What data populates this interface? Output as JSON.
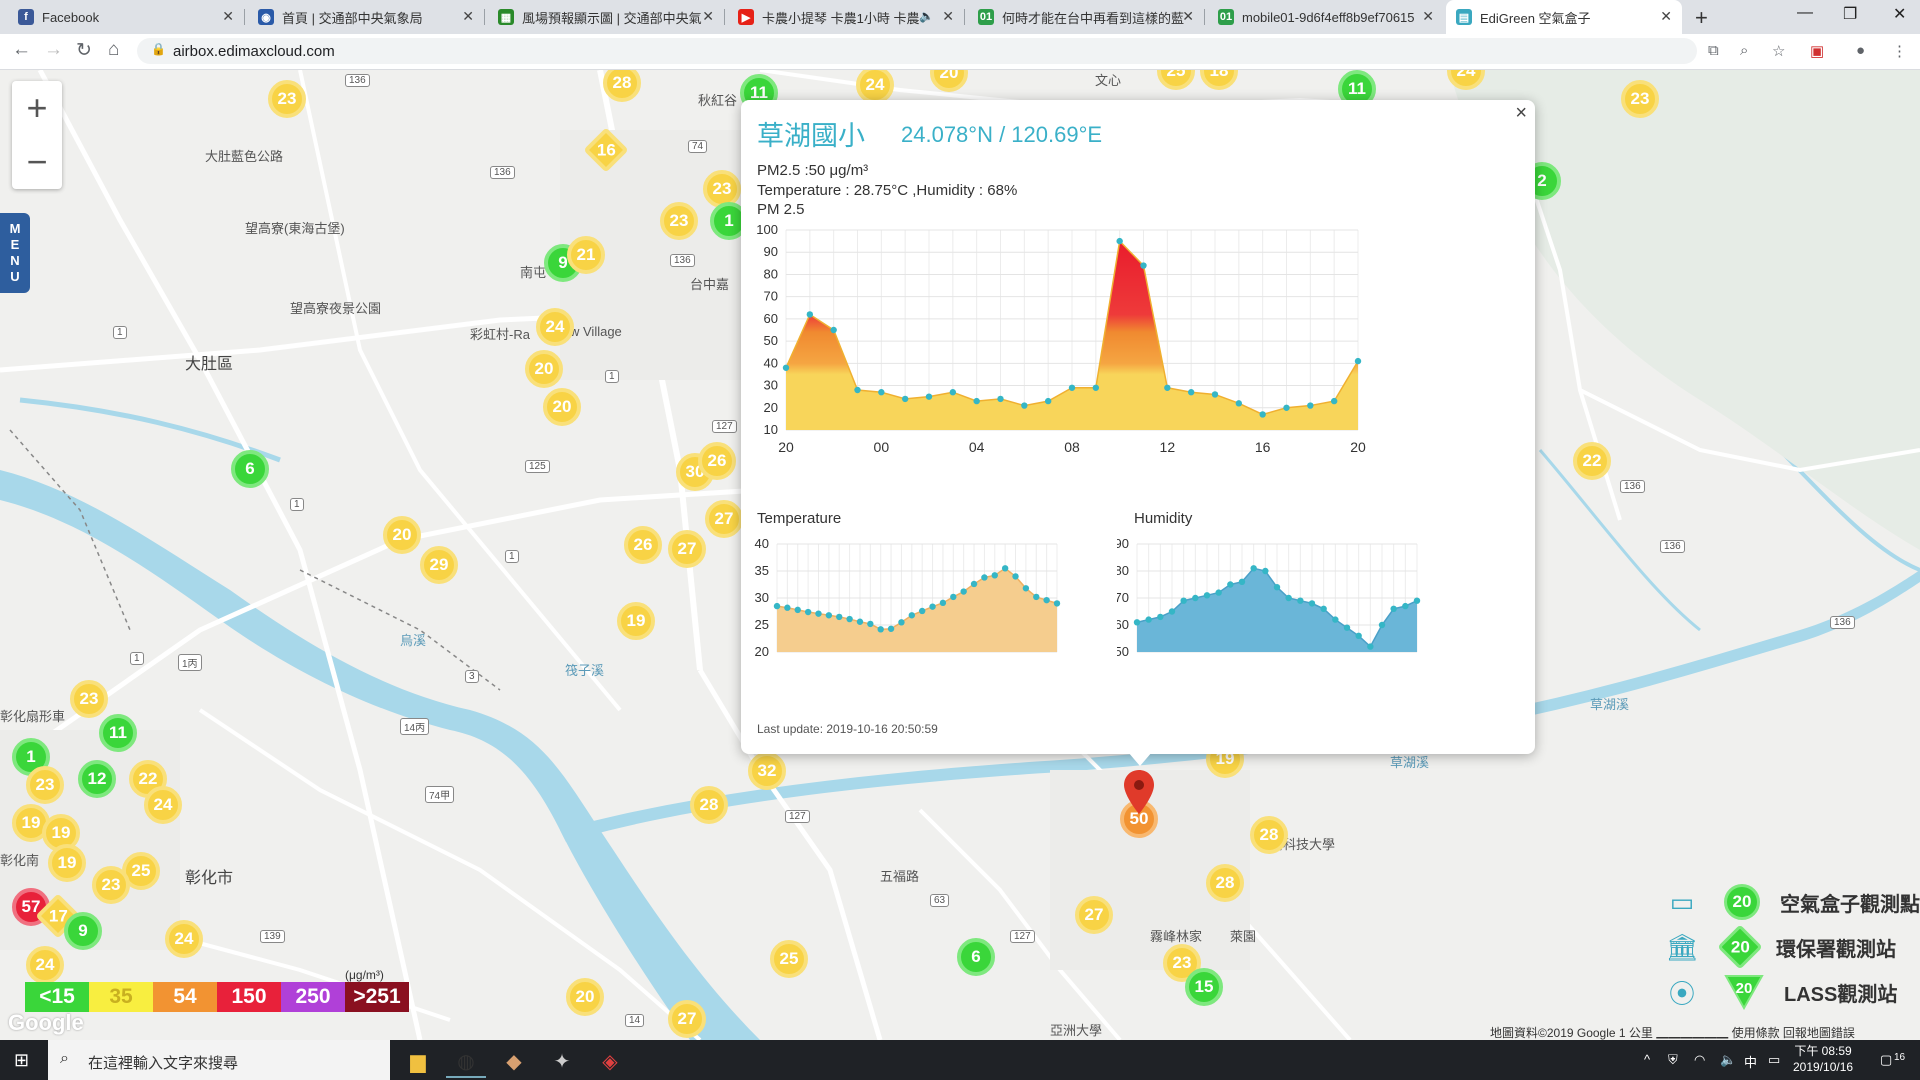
{
  "browser": {
    "tabs": [
      {
        "label": "Facebook",
        "icon": "facebook-icon",
        "color": "#3b5998",
        "glyph": "f"
      },
      {
        "label": "首頁 | 交通部中央氣象局",
        "icon": "cwb-icon",
        "color": "#2a5aa8",
        "glyph": "◉"
      },
      {
        "label": "風場預報顯示圖 | 交通部中央氣",
        "icon": "cwb-wind-icon",
        "color": "#2a8a2a",
        "glyph": "▦"
      },
      {
        "label": "卡農小提琴 卡農1小時 卡農",
        "icon": "youtube-icon",
        "color": "#e62117",
        "glyph": "▶"
      },
      {
        "label": "何時才能在台中再看到這樣的藍",
        "icon": "mobile01-icon",
        "color": "#2e9e4a",
        "glyph": "01"
      },
      {
        "label": "mobile01-9d6f4eff8b9ef70615",
        "icon": "mobile01-icon",
        "color": "#2e9e4a",
        "glyph": "01"
      },
      {
        "label": "EdiGreen 空氣盒子",
        "icon": "edigreen-icon",
        "color": "#3aa8c0",
        "glyph": "▤"
      }
    ],
    "url": "airbox.edimaxcloud.com"
  },
  "popup": {
    "site_name": "草湖國小",
    "coords": "24.078°N / 120.69°E",
    "pm25_line": "PM2.5 :50 μg/m³",
    "temp_hum_line": "Temperature : 28.75°C ,Humidity : 68%",
    "pm_label": "PM 2.5",
    "temp_label": "Temperature",
    "hum_label": "Humidity",
    "last_update": "Last update: 2019-10-16 20:50:59",
    "close_glyph": "×"
  },
  "chart_data": [
    {
      "type": "area",
      "title": "PM 2.5",
      "xticks": [
        "20",
        "00",
        "04",
        "08",
        "12",
        "16",
        "20"
      ],
      "yticks": [
        10,
        20,
        30,
        40,
        50,
        60,
        70,
        80,
        90,
        100
      ],
      "ylim": [
        10,
        100
      ],
      "x": [
        0,
        1,
        2,
        3,
        4,
        5,
        6,
        7,
        8,
        9,
        10,
        11,
        12,
        13,
        14,
        15,
        16,
        17,
        18,
        19,
        20,
        21,
        22,
        23,
        24
      ],
      "values": [
        38,
        62,
        55,
        28,
        27,
        24,
        25,
        27,
        23,
        24,
        21,
        23,
        29,
        29,
        95,
        84,
        29,
        27,
        26,
        22,
        17,
        20,
        21,
        23,
        41
      ],
      "grid": true
    },
    {
      "type": "area",
      "title": "Temperature",
      "yticks": [
        20,
        25,
        30,
        35,
        40
      ],
      "ylim": [
        20,
        40
      ],
      "values": [
        28.5,
        28.2,
        27.8,
        27.4,
        27.1,
        26.8,
        26.5,
        26.1,
        25.6,
        25.2,
        24.2,
        24.3,
        25.5,
        26.8,
        27.6,
        28.4,
        29.1,
        30.2,
        31.2,
        32.6,
        33.8,
        34.2,
        35.5,
        34.0,
        31.8,
        30.2,
        29.6,
        29.0
      ],
      "grid": true
    },
    {
      "type": "area",
      "title": "Humidity",
      "yticks": [
        50,
        60,
        70,
        80,
        90
      ],
      "ylim": [
        50,
        90
      ],
      "values": [
        61,
        62,
        63,
        65,
        69,
        70,
        71,
        72,
        75,
        76,
        81,
        80,
        74,
        70,
        69,
        68,
        66,
        62,
        59,
        56,
        52,
        60,
        66,
        67,
        69
      ],
      "grid": true
    }
  ],
  "map": {
    "labels": [
      {
        "t": "大肚藍色公路",
        "k": "a"
      },
      {
        "t": "望高寮(東海古堡)",
        "k": "b"
      },
      {
        "t": "望高寮夜景公園",
        "k": "c"
      },
      {
        "t": "大肚區",
        "k": "d"
      },
      {
        "t": "彩虹村-Ra",
        "k": "e"
      },
      {
        "t": "w Village",
        "k": "f"
      },
      {
        "t": "南屯",
        "k": "g"
      },
      {
        "t": "台中嘉",
        "k": "h"
      },
      {
        "t": "秋紅谷",
        "k": "i"
      },
      {
        "t": "文心",
        "k": "j"
      },
      {
        "t": "彰化扇形車",
        "k": "k"
      },
      {
        "t": "彰化南",
        "k": "l"
      },
      {
        "t": "彰化市",
        "k": "m"
      },
      {
        "t": "霧峰林家",
        "k": "n"
      },
      {
        "t": "萊園",
        "k": "o"
      },
      {
        "t": "亞洲大學",
        "k": "p"
      },
      {
        "t": "陽科技大學",
        "k": "q"
      },
      {
        "t": "草湖溪",
        "k": "r"
      },
      {
        "t": "五福路",
        "k": "s"
      },
      {
        "t": "筏子溪",
        "k": "t"
      },
      {
        "t": "烏溪",
        "k": "u"
      },
      {
        "t": "草湖溪",
        "k": "v"
      }
    ],
    "markers": [
      {
        "v": "23",
        "c": "y"
      },
      {
        "v": "28",
        "c": "y"
      },
      {
        "v": "16",
        "c": "y",
        "d": true
      },
      {
        "v": "11",
        "c": "g"
      },
      {
        "v": "24",
        "c": "y"
      },
      {
        "v": "20",
        "c": "y"
      },
      {
        "v": "25",
        "c": "y"
      },
      {
        "v": "18",
        "c": "y"
      },
      {
        "v": "11",
        "c": "g"
      },
      {
        "v": "24",
        "c": "y"
      },
      {
        "v": "23",
        "c": "y"
      },
      {
        "v": "23",
        "c": "y"
      },
      {
        "v": "23",
        "c": "y"
      },
      {
        "v": "1",
        "c": "g"
      },
      {
        "v": "9",
        "c": "g"
      },
      {
        "v": "21",
        "c": "y"
      },
      {
        "v": "24",
        "c": "y"
      },
      {
        "v": "20",
        "c": "y"
      },
      {
        "v": "20",
        "c": "y"
      },
      {
        "v": "2",
        "c": "g"
      },
      {
        "v": "6",
        "c": "g"
      },
      {
        "v": "30",
        "c": "y"
      },
      {
        "v": "26",
        "c": "y"
      },
      {
        "v": "27",
        "c": "y"
      },
      {
        "v": "27",
        "c": "y"
      },
      {
        "v": "26",
        "c": "y"
      },
      {
        "v": "20",
        "c": "y"
      },
      {
        "v": "29",
        "c": "y"
      },
      {
        "v": "19",
        "c": "y"
      },
      {
        "v": "22",
        "c": "y"
      },
      {
        "v": "23",
        "c": "y"
      },
      {
        "v": "11",
        "c": "g"
      },
      {
        "v": "1",
        "c": "g"
      },
      {
        "v": "12",
        "c": "g"
      },
      {
        "v": "22",
        "c": "y"
      },
      {
        "v": "23",
        "c": "y"
      },
      {
        "v": "24",
        "c": "y"
      },
      {
        "v": "19",
        "c": "y"
      },
      {
        "v": "19",
        "c": "y"
      },
      {
        "v": "19",
        "c": "y"
      },
      {
        "v": "25",
        "c": "y"
      },
      {
        "v": "23",
        "c": "y"
      },
      {
        "v": "57",
        "c": "r"
      },
      {
        "v": "17",
        "c": "y",
        "d": true
      },
      {
        "v": "9",
        "c": "g"
      },
      {
        "v": "24",
        "c": "y"
      },
      {
        "v": "24",
        "c": "y"
      },
      {
        "v": "32",
        "c": "y"
      },
      {
        "v": "28",
        "c": "y"
      },
      {
        "v": "50",
        "c": "o"
      },
      {
        "v": "28",
        "c": "y"
      },
      {
        "v": "28",
        "c": "y"
      },
      {
        "v": "27",
        "c": "y"
      },
      {
        "v": "25",
        "c": "y"
      },
      {
        "v": "6",
        "c": "g"
      },
      {
        "v": "23",
        "c": "y"
      },
      {
        "v": "15",
        "c": "g"
      },
      {
        "v": "20",
        "c": "y"
      },
      {
        "v": "27",
        "c": "y"
      },
      {
        "v": "22",
        "c": "y"
      },
      {
        "v": "19",
        "c": "y"
      }
    ],
    "shields": [
      "136",
      "136",
      "74",
      "136",
      "127",
      "125",
      "1",
      "1",
      "3",
      "1",
      "1",
      "127",
      "63",
      "127",
      "139",
      "14",
      "136",
      "136",
      "136",
      "1",
      "74",
      "1丙",
      "74甲",
      "14丙"
    ]
  },
  "zoom": {
    "in": "+",
    "out": "−"
  },
  "menu_tab": "MENU",
  "pm_scale": [
    {
      "label": "<15",
      "color": "#3ad63a"
    },
    {
      "label": "35",
      "color": "#f8ee40"
    },
    {
      "label": "54",
      "color": "#f29332"
    },
    {
      "label": "150",
      "color": "#e8213a"
    },
    {
      "label": "250",
      "color": "#b040d8"
    },
    {
      "label": ">251",
      "color": "#8a1020"
    }
  ],
  "pm_unit": "(μg/m³)",
  "google_logo": "Google",
  "map_footer": "地圖資料©2019 Google    1 公里 ▁▁▁▁▁▁    使用條款    回報地圖錯誤",
  "legend": [
    {
      "text": "空氣盒子觀測點",
      "value": "20",
      "icon": "airbox-icon"
    },
    {
      "text": "環保署觀測站",
      "value": "20",
      "icon": "epa-building-icon"
    },
    {
      "text": "LASS觀測站",
      "value": "20",
      "icon": "lass-antenna-icon"
    }
  ],
  "taskbar": {
    "search_placeholder": "在這裡輸入文字來搜尋",
    "time": "下午 08:59",
    "date": "2019/10/16",
    "ime": "中",
    "notif_count": "16"
  }
}
